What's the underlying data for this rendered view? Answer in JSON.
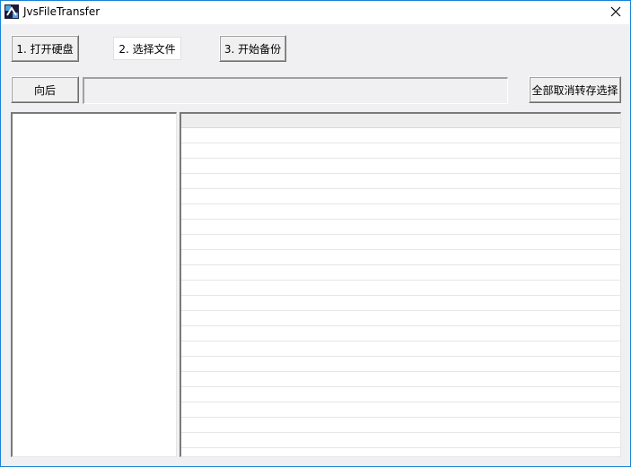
{
  "window": {
    "title": "JvsFileTransfer"
  },
  "toolbar": {
    "open_disk_label": "1. 打开硬盘",
    "select_files_label": "2. 选择文件",
    "start_backup_label": "3. 开始备份"
  },
  "nav": {
    "back_label": "向后",
    "path_value": "",
    "cancel_all_label": "全部取消转存选择"
  },
  "icons": {
    "app": "app-icon",
    "close": "close-icon"
  }
}
